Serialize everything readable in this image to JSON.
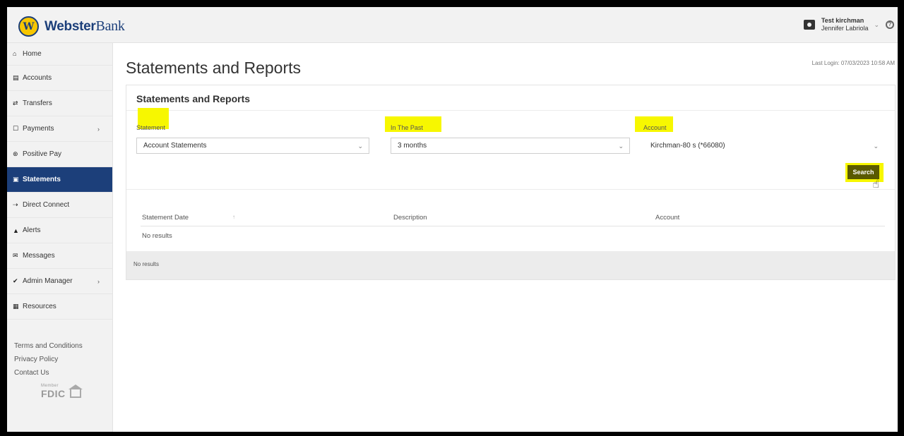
{
  "brand": {
    "name_bold": "Webster",
    "name_rest": "Bank",
    "logo_letter": "W"
  },
  "header": {
    "user_name": "Test kirchman",
    "user_sub": "Jennifer Labriola",
    "caret": "⌄",
    "help": "?"
  },
  "sidebar": {
    "items": [
      {
        "icon": "⌂",
        "label": "Home"
      },
      {
        "icon": "▤",
        "label": "Accounts"
      },
      {
        "icon": "⇄",
        "label": "Transfers"
      },
      {
        "icon": "☐",
        "label": "Payments",
        "chevron": "›"
      },
      {
        "icon": "⊛",
        "label": "Positive Pay"
      },
      {
        "icon": "▣",
        "label": "Statements"
      },
      {
        "icon": "⇢",
        "label": "Direct Connect"
      },
      {
        "icon": "▲",
        "label": "Alerts"
      },
      {
        "icon": "✉",
        "label": "Messages"
      },
      {
        "icon": "✔",
        "label": "Admin Manager",
        "chevron": "›"
      },
      {
        "icon": "▦",
        "label": "Resources"
      }
    ],
    "footer_links": [
      "Terms and Conditions",
      "Privacy Policy",
      "Contact Us"
    ],
    "fdic": {
      "text": "FDIC",
      "member": "Member"
    }
  },
  "main": {
    "page_title": "Statements and Reports",
    "last_login": "Last Login: 07/03/2023 10:58 AM",
    "card_title": "Statements and Reports",
    "filters": {
      "statement": {
        "label": "Statement",
        "value": "Account Statements"
      },
      "in_the_past": {
        "label": "In The Past",
        "value": "3 months"
      },
      "account": {
        "label": "Account",
        "value": "Kirchman-80 s (*66080)"
      }
    },
    "search_label": "Search",
    "table": {
      "columns": [
        "Statement Date",
        "Description",
        "Account"
      ],
      "sort_icon": "↑",
      "empty": "No results"
    },
    "footer_text": "No results"
  },
  "colors": {
    "nav_active": "#1c3f7a",
    "highlight": "#f7f700",
    "search_bg": "#5a5a00"
  }
}
